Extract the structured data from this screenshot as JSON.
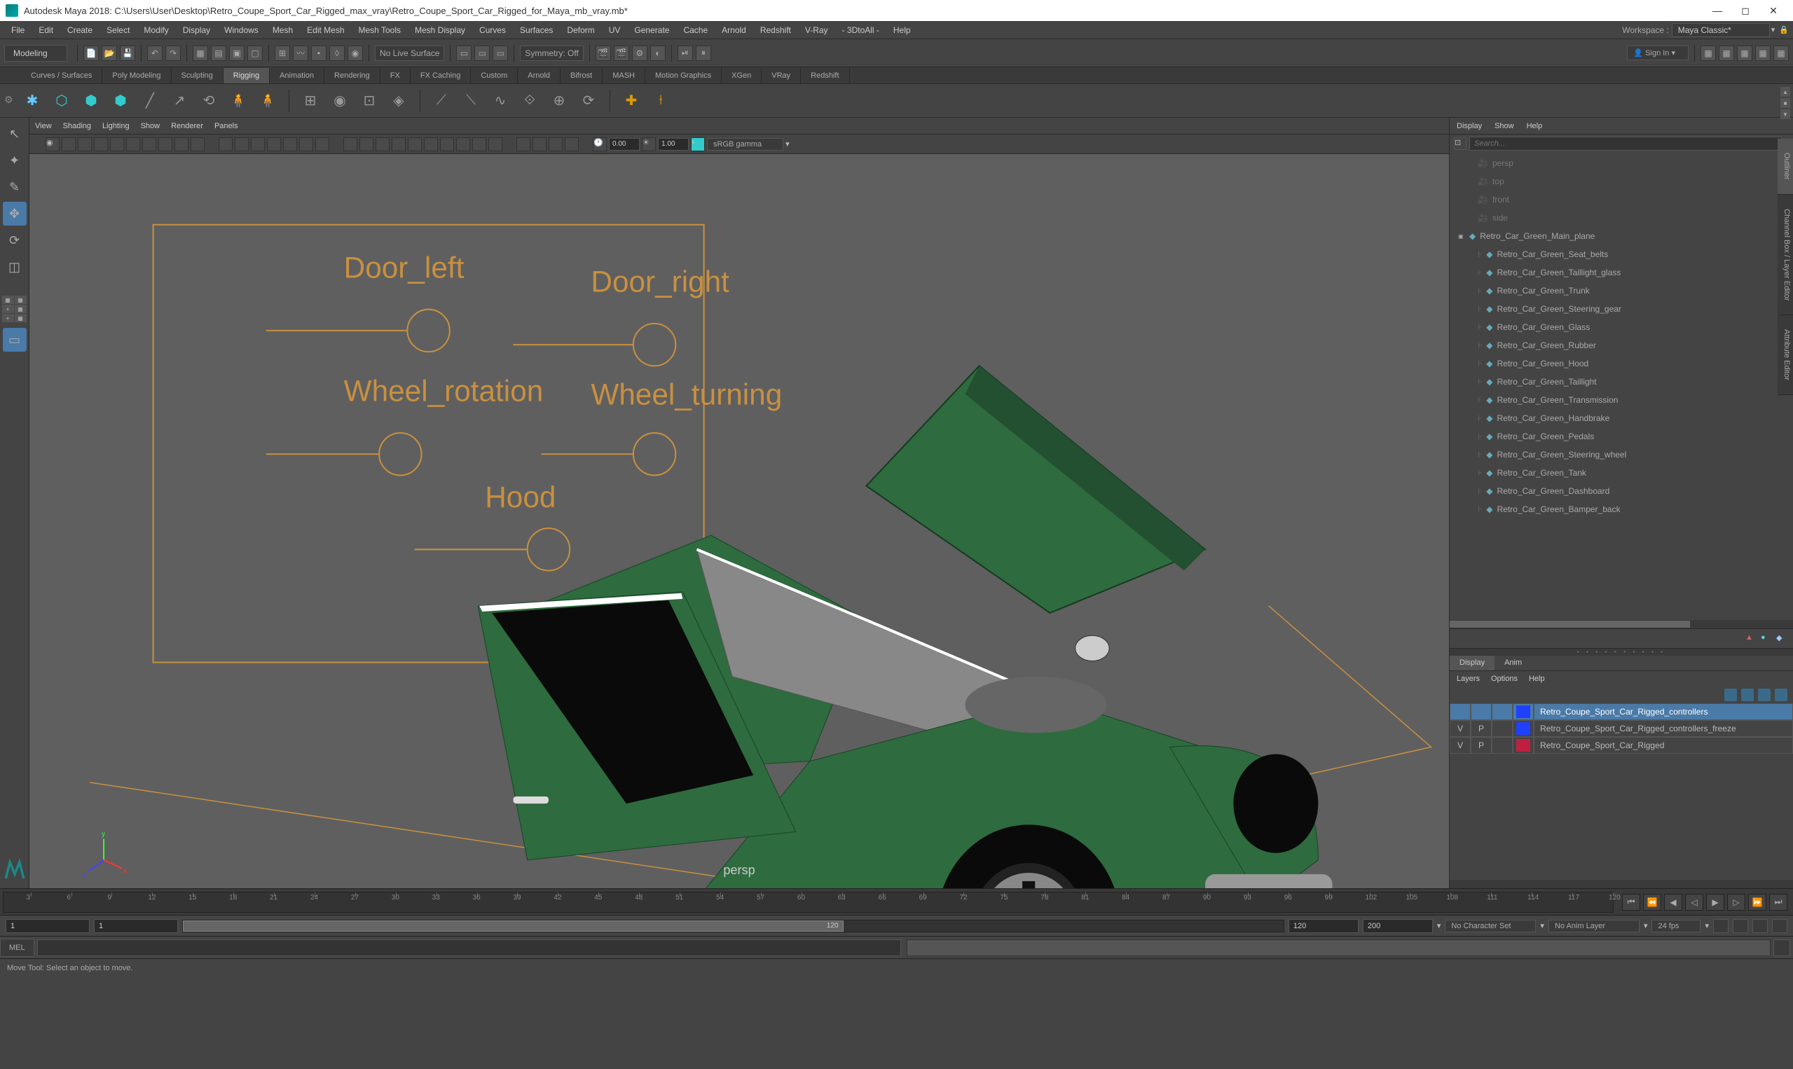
{
  "window": {
    "title": "Autodesk Maya 2018: C:\\Users\\User\\Desktop\\Retro_Coupe_Sport_Car_Rigged_max_vray\\Retro_Coupe_Sport_Car_Rigged_for_Maya_mb_vray.mb*"
  },
  "menubar": {
    "items": [
      "File",
      "Edit",
      "Create",
      "Select",
      "Modify",
      "Display",
      "Windows",
      "Mesh",
      "Edit Mesh",
      "Mesh Tools",
      "Mesh Display",
      "Curves",
      "Surfaces",
      "Deform",
      "UV",
      "Generate",
      "Cache",
      "Arnold",
      "Redshift",
      "V-Ray",
      "- 3DtoAll -",
      "Help"
    ],
    "workspace_label": "Workspace :",
    "workspace_value": "Maya Classic*"
  },
  "toolrow": {
    "mode": "Modeling",
    "live_surface": "No Live Surface",
    "symmetry": "Symmetry: Off",
    "signin": "Sign In"
  },
  "tabs": [
    "Curves / Surfaces",
    "Poly Modeling",
    "Sculpting",
    "Rigging",
    "Animation",
    "Rendering",
    "FX",
    "FX Caching",
    "Custom",
    "Arnold",
    "Bifrost",
    "MASH",
    "Motion Graphics",
    "XGen",
    "VRay",
    "Redshift"
  ],
  "tabs_active": 3,
  "viewmenu": [
    "View",
    "Shading",
    "Lighting",
    "Show",
    "Renderer",
    "Panels"
  ],
  "viewport": {
    "time_value": "0.00",
    "exposure": "1.00",
    "gamma": "sRGB gamma",
    "camera_label": "persp",
    "rig_labels": {
      "door_left": "Door_left",
      "door_right": "Door_right",
      "wheel_rotation": "Wheel_rotation",
      "wheel_turning": "Wheel_turning",
      "hood": "Hood"
    }
  },
  "outliner": {
    "menu": [
      "Display",
      "Show",
      "Help"
    ],
    "search_placeholder": "Search...",
    "cameras": [
      "persp",
      "top",
      "front",
      "side"
    ],
    "root": "Retro_Car_Green_Main_plane",
    "children": [
      "Retro_Car_Green_Seat_belts",
      "Retro_Car_Green_Taillight_glass",
      "Retro_Car_Green_Trunk",
      "Retro_Car_Green_Steering_gear",
      "Retro_Car_Green_Glass",
      "Retro_Car_Green_Rubber",
      "Retro_Car_Green_Hood",
      "Retro_Car_Green_Taillight",
      "Retro_Car_Green_Transmission",
      "Retro_Car_Green_Handbrake",
      "Retro_Car_Green_Pedals",
      "Retro_Car_Green_Steering_wheel",
      "Retro_Car_Green_Tank",
      "Retro_Car_Green_Dashboard",
      "Retro_Car_Green_Bamper_back"
    ]
  },
  "channelbox": {
    "tabs": [
      "Display",
      "Anim"
    ],
    "menu": [
      "Layers",
      "Options",
      "Help"
    ],
    "layer_headers": [
      "V",
      "P"
    ],
    "layers": [
      {
        "v": "",
        "p": "",
        "color": "#2040ff",
        "name": "Retro_Coupe_Sport_Car_Rigged_controllers",
        "selected": true
      },
      {
        "v": "V",
        "p": "P",
        "color": "#2040ff",
        "name": "Retro_Coupe_Sport_Car_Rigged_controllers_freeze",
        "selected": false
      },
      {
        "v": "V",
        "p": "P",
        "color": "#c02040",
        "name": "Retro_Coupe_Sport_Car_Rigged",
        "selected": false
      }
    ]
  },
  "right_tabs": [
    "Outliner",
    "Channel Box / Layer Editor",
    "Attribute Editor"
  ],
  "timeline": {
    "start_outer": "1",
    "start_inner": "1",
    "end_inner": "120",
    "end_outer": "120",
    "end_field2": "200",
    "character": "No Character Set",
    "anim_layer": "No Anim Layer",
    "fps": "24 fps"
  },
  "cmd": {
    "lang": "MEL"
  },
  "status": "Move Tool: Select an object to move."
}
